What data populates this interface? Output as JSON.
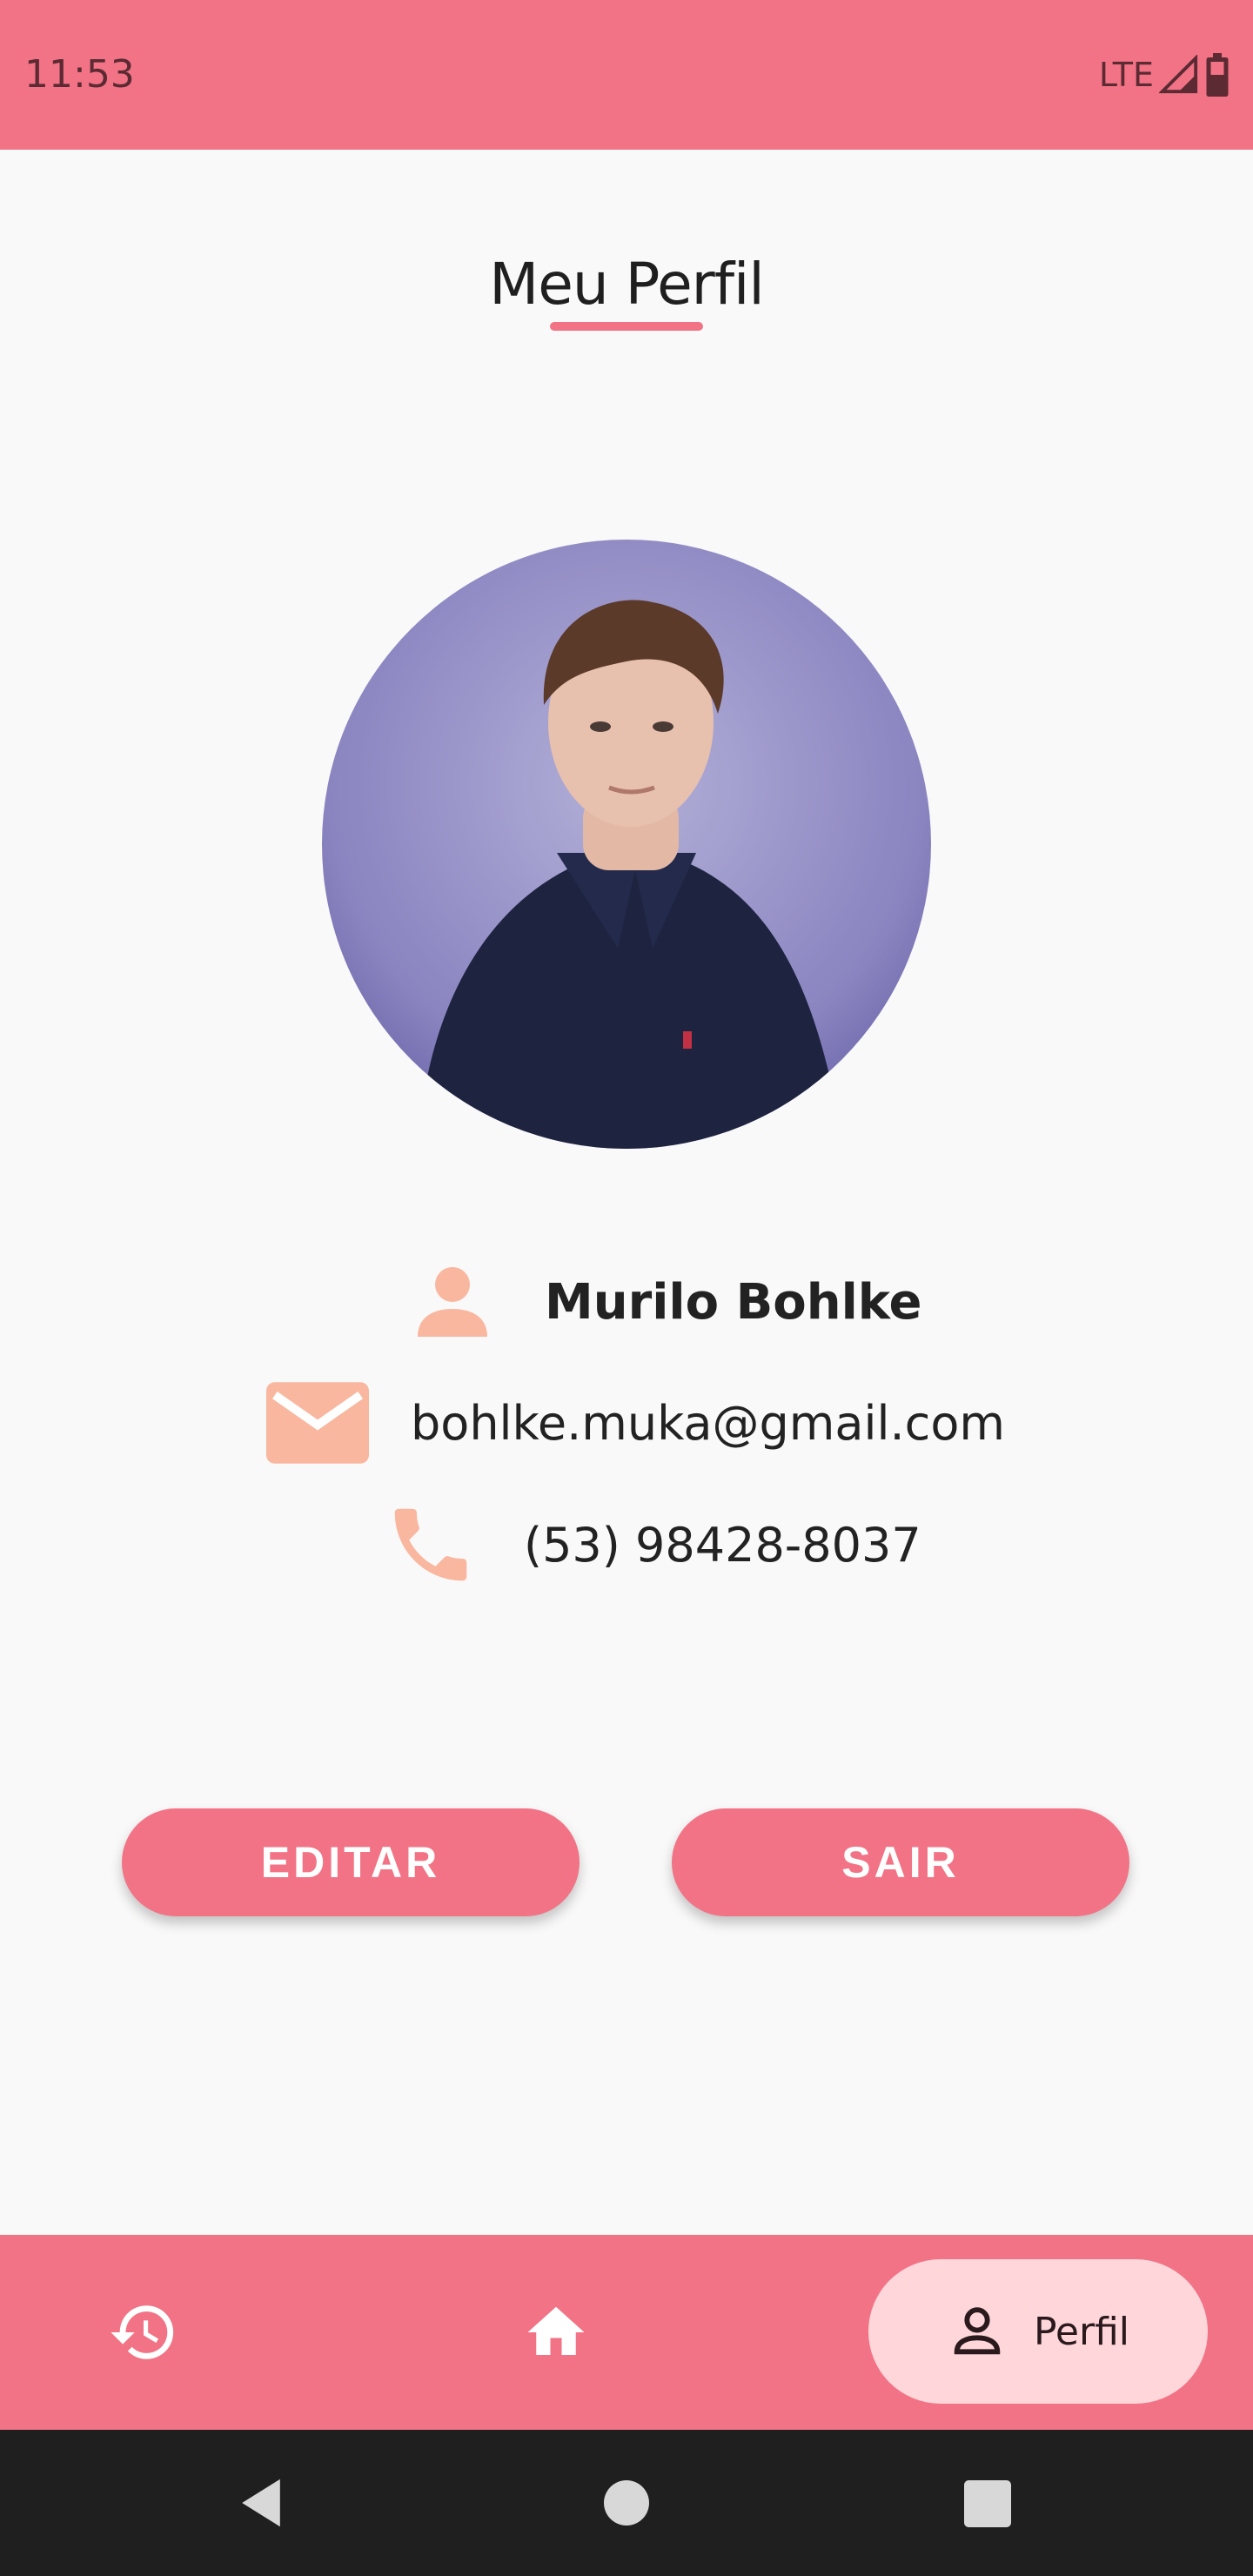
{
  "status_bar": {
    "time": "11:53",
    "network": "LTE"
  },
  "header": {
    "title": "Meu Perfil"
  },
  "profile": {
    "name": "Murilo Bohlke",
    "email": "bohlke.muka@gmail.com",
    "phone": "(53) 98428-8037"
  },
  "actions": {
    "edit_label": "EDITAR",
    "logout_label": "SAIR"
  },
  "bottom_nav": {
    "items": [
      {
        "icon": "history-icon"
      },
      {
        "icon": "home-icon"
      },
      {
        "icon": "person-outline-icon",
        "label": "Perfil",
        "active": true
      }
    ]
  },
  "colors": {
    "accent": "#f27385",
    "icon_peach": "#f9b79f",
    "nav_active_bg": "#ffd6da"
  }
}
